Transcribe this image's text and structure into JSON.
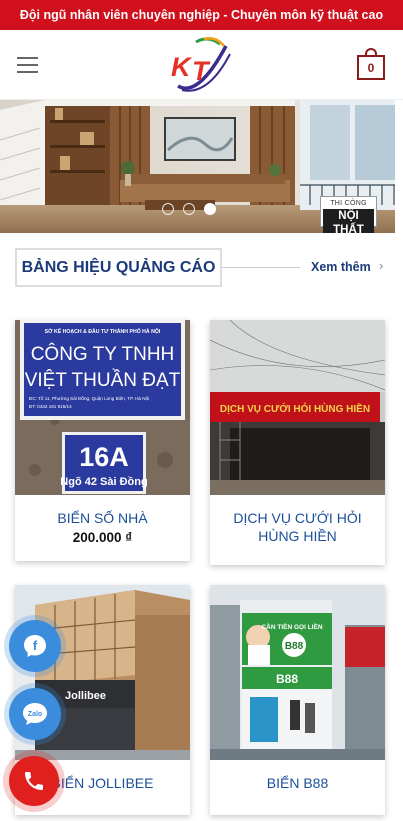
{
  "topbar": {
    "text": "Đội ngũ nhân viên chuyên nghiệp - Chuyên môn kỹ thuật cao"
  },
  "header": {
    "cart_count": "0",
    "logo_alt": "KT"
  },
  "banner": {
    "badge_small": "THI CÔNG",
    "badge_big": "NỘI THẤT",
    "slides": 3,
    "active_slide": 3
  },
  "section": {
    "title": "BẢNG HIỆU QUẢNG CÁO",
    "see_more": "Xem thêm",
    "chevron": "›"
  },
  "products": [
    {
      "name": "BIỂN SỐ NHÀ",
      "price": "200.000 ₫",
      "sign_lines": [
        "SỞ KẾ HOẠCH & ĐẦU TƯ THÀNH PHỐ HÀ NỘI",
        "CÔNG TY TNHH",
        "VIỆT THUẦN ĐẠT",
        "ĐC: Tổ 11, Phường Sài Đồng, Quận Long Biên, TP. Hà Nội",
        "ĐT: 0432 161 915/14"
      ],
      "house_number": "16A",
      "street": "Ngõ 42 Sài Đồng"
    },
    {
      "name": "DỊCH VỤ CƯỚI HỎI HÙNG HIỀN",
      "price": "",
      "sign_text": "DỊCH VỤ CƯỚI HỎI HÙNG HIỀN"
    },
    {
      "name": "BIỂN JOLLIBEE",
      "price": "",
      "sign_text": "Jollibee"
    },
    {
      "name": "BIỂN B88",
      "price": "",
      "sign_text": "CẦN TIỀN GỌI LIỀN",
      "brand": "B88"
    }
  ],
  "floating": {
    "facebook": "f",
    "zalo": "Zalo"
  },
  "colors": {
    "topbar": "#d0101c",
    "title": "#1c3a7a",
    "link": "#1c4f9a",
    "fab_blue": "#3b8cdc",
    "fab_red": "#e0201f"
  }
}
